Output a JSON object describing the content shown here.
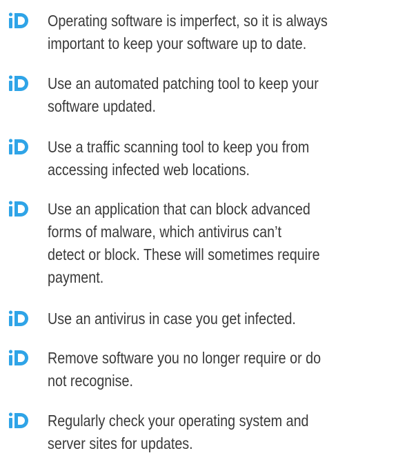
{
  "brand": {
    "accent_color": "#2fa4e7",
    "bullet_icon": "id-logo-icon"
  },
  "tips": [
    {
      "lines": [
        "Operating software is imperfect, so it is always",
        "important to keep your software up to date."
      ]
    },
    {
      "lines": [
        "Use an automated patching tool to keep your",
        "software updated."
      ]
    },
    {
      "lines": [
        "Use a traffic scanning tool to keep you from",
        "accessing infected web locations."
      ]
    },
    {
      "lines": [
        "Use an application that can block advanced",
        "forms of malware, which antivirus can’t",
        "detect or block. These will sometimes require",
        "payment."
      ]
    },
    {
      "lines": [
        "Use an antivirus in case you get infected."
      ]
    },
    {
      "lines": [
        "Remove software you no longer require or do",
        "not recognise."
      ]
    },
    {
      "lines": [
        "Regularly check your operating system and",
        "server sites for updates."
      ]
    }
  ]
}
